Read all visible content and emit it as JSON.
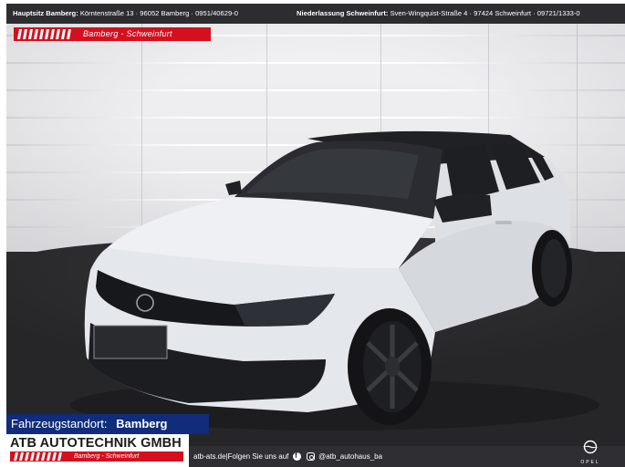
{
  "topbar": {
    "hq_label": "Hauptsitz Bamberg:",
    "hq_address": "Körntenstraße 13 · 96052 Bamberg · 0951/40629-0",
    "branch_label": "Niederlassung Schweinfurt:",
    "branch_address": "Sven-Wingquist-Straße 4 · 97424 Schweinfurt · 09721/1333-0"
  },
  "ribbon": {
    "text": "Bamberg - Schweinfurt"
  },
  "location": {
    "label": "Fahrzeugstandort:",
    "value": "Bamberg"
  },
  "brand": {
    "name": "ATB AUTOTECHNIK GMBH",
    "tagline": "Bamberg - Schweinfurt"
  },
  "footer": {
    "website": "atb-ats.de",
    "follow": "Folgen Sie uns auf",
    "handle": "@atb_autohaus_ba",
    "oem_logo": "OPEL"
  },
  "colors": {
    "brand_red": "#d4101f",
    "location_blue": "#102c7a",
    "bar_dark": "#2d2d30",
    "car_body": "#e9ebee"
  },
  "icons": [
    "facebook-icon",
    "instagram-icon",
    "opel-blitz-icon"
  ]
}
